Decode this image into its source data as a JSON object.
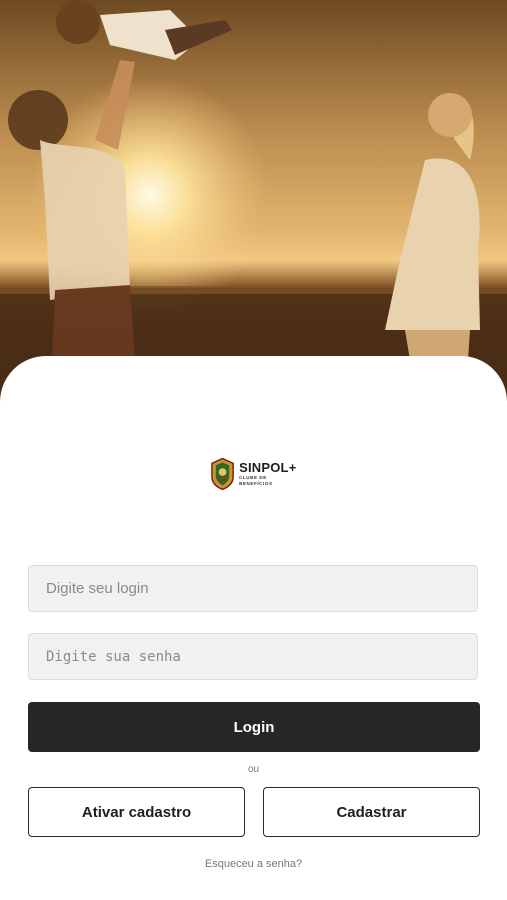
{
  "hero": {
    "image": "family-sunset-photo"
  },
  "logo": {
    "name": "SINPOL",
    "plus": "+",
    "subtitle": "CLUBE DE BENEFÍCIOS",
    "emblem": "badge-emblem-icon"
  },
  "form": {
    "login_placeholder": "Digite seu login",
    "password_placeholder": "Digite sua senha",
    "login_button": "Login",
    "or_text": "ou",
    "activate_button": "Ativar cadastro",
    "register_button": "Cadastrar",
    "forgot_link": "Esqueceu a senha?"
  },
  "colors": {
    "primary_button": "#262626",
    "input_background": "#f1f1f1",
    "muted_text": "#777777"
  }
}
